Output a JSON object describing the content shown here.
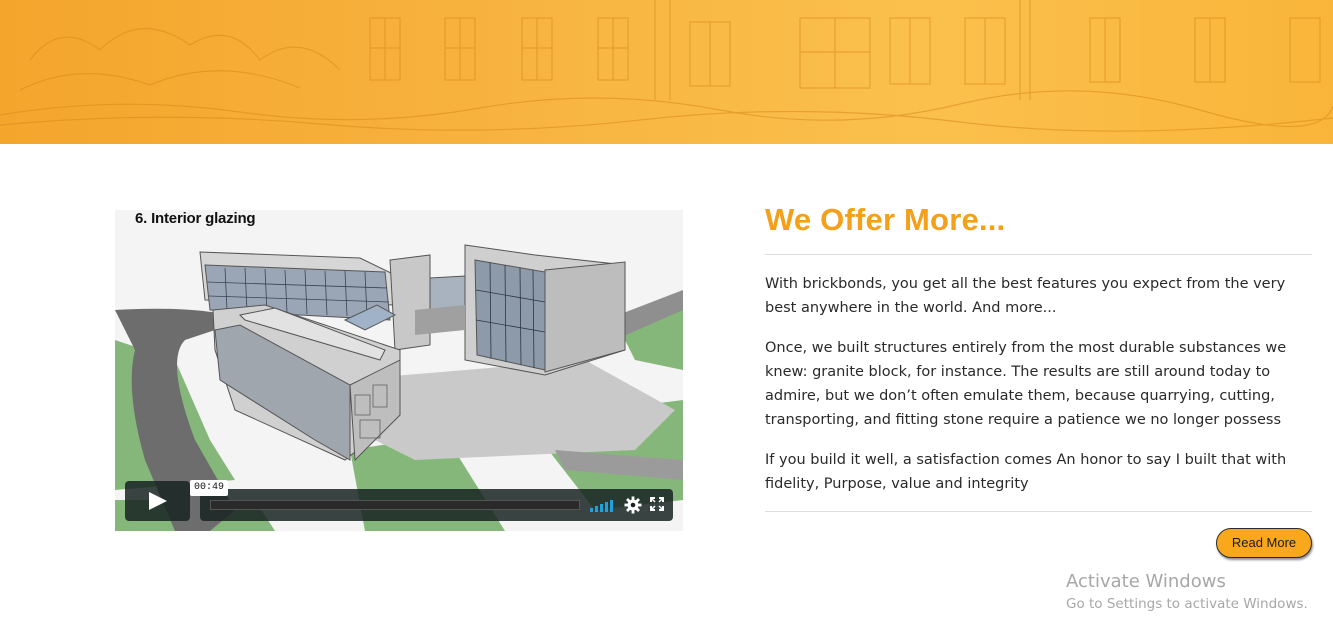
{
  "video": {
    "caption": "6. Interior glazing",
    "time": "00:49",
    "progress_fraction": 0.0
  },
  "offer": {
    "title": "We Offer More...",
    "paragraphs": [
      "With brickbonds, you get all the best features you expect from the very best anywhere in the world. And more...",
      "Once, we built structures entirely from the most durable substances we knew: granite block, for instance. The results are still around today to admire, but we don’t often emulate them, because quarrying, cutting, transporting, and fitting stone require a patience we no longer possess",
      "If you build it well, a satisfaction comes An honor to say I built that with fidelity, Purpose, value and integrity"
    ],
    "read_more_label": "Read More"
  },
  "watermark": {
    "title": "Activate Windows",
    "subtitle": "Go to Settings to activate Windows."
  },
  "colors": {
    "accent": "#f5a01a",
    "button": "#f9a81b",
    "banner": "#f7b23e",
    "player_bar": "#172322",
    "volume": "#1ea3e0"
  },
  "icons": [
    "play-icon",
    "volume-icon",
    "settings-icon",
    "fullscreen-icon"
  ]
}
